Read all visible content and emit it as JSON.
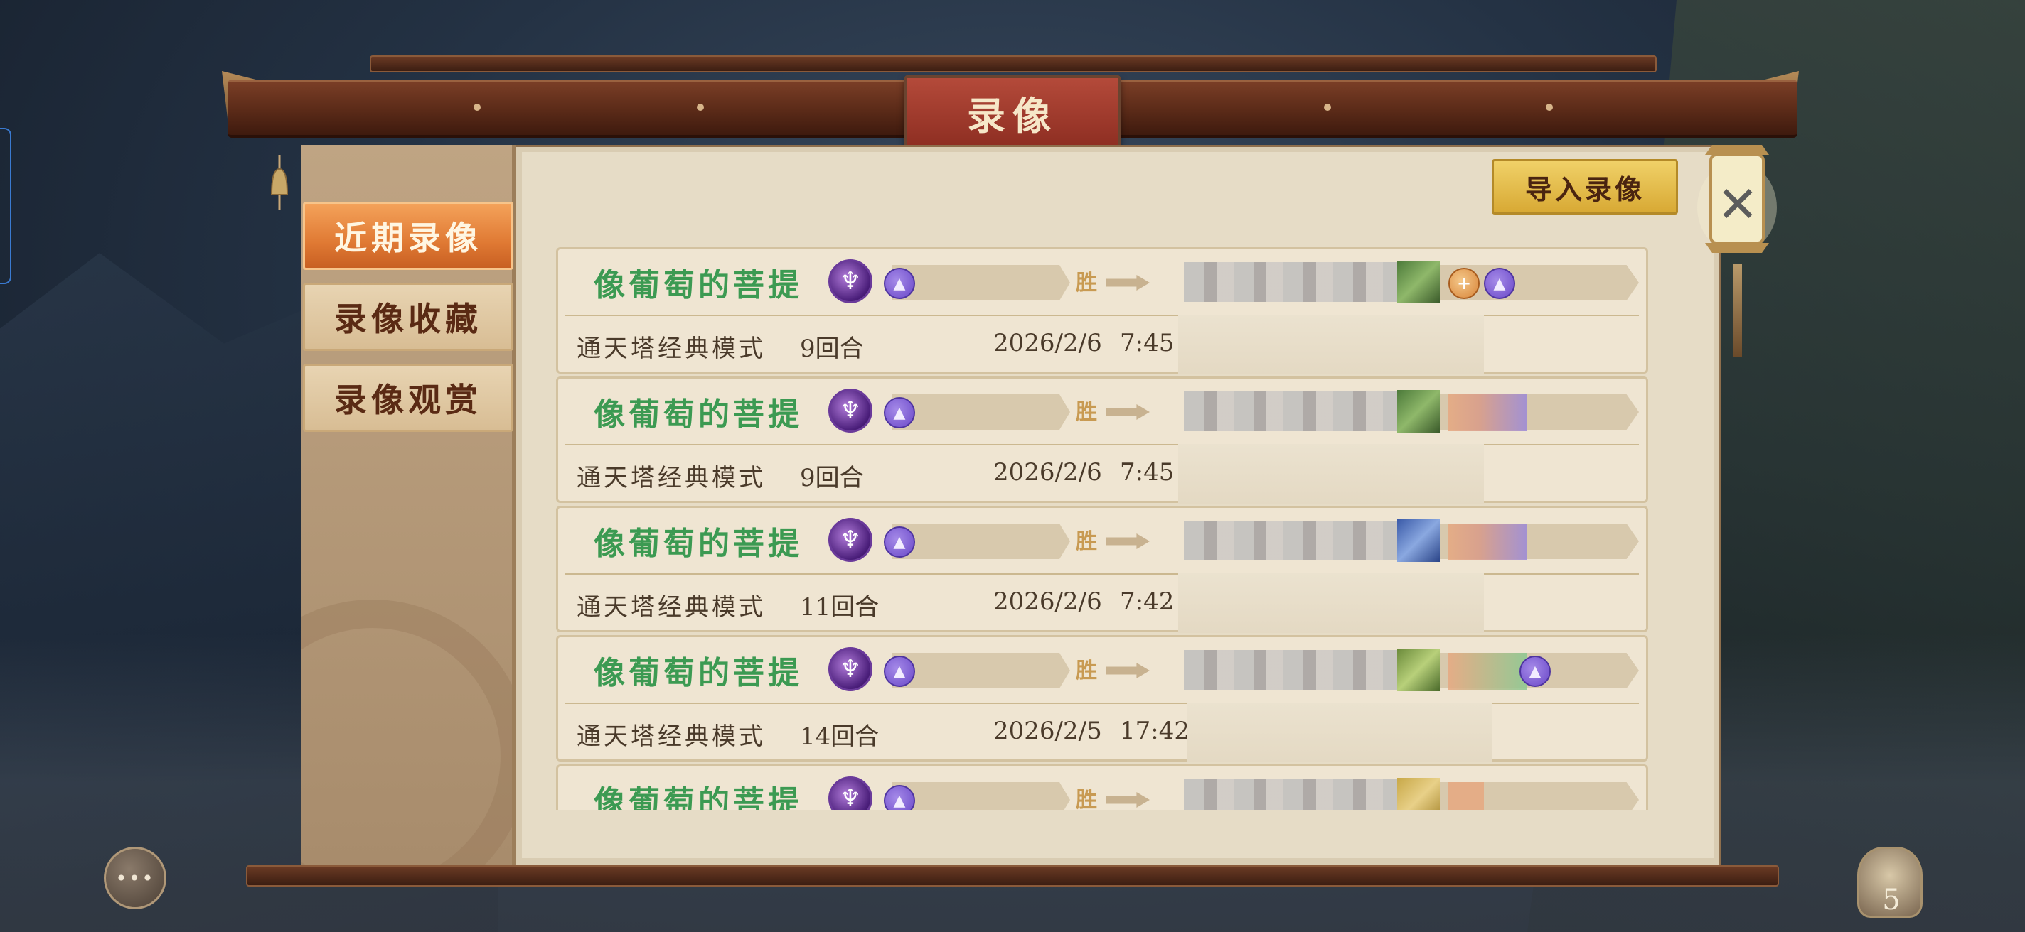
{
  "window": {
    "title": "录像"
  },
  "toolbar": {
    "import_label": "导入录像",
    "close_icon": "✕"
  },
  "sidebar": {
    "items": [
      {
        "label": "近期录像",
        "active": true
      },
      {
        "label": "录像收藏",
        "active": false
      },
      {
        "label": "录像观赏",
        "active": false
      }
    ]
  },
  "colors": {
    "accent_orange": "#e07a34",
    "name_green": "#3c9a52",
    "title_red": "#8e2e22",
    "import_gold": "#d8a934"
  },
  "icons": {
    "player_main": "hero-icon",
    "player_sub": "skill-icon",
    "result_arrow": "arrow-right-icon",
    "chat": "chat-icon",
    "bag": "bag-icon"
  },
  "records": [
    {
      "player": "像葡萄的菩提",
      "result": "胜",
      "mode": "通天塔经典模式",
      "rounds": "9回合",
      "date": "2026/2/6",
      "time": "7:45"
    },
    {
      "player": "像葡萄的菩提",
      "result": "胜",
      "mode": "通天塔经典模式",
      "rounds": "9回合",
      "date": "2026/2/6",
      "time": "7:45"
    },
    {
      "player": "像葡萄的菩提",
      "result": "胜",
      "mode": "通天塔经典模式",
      "rounds": "11回合",
      "date": "2026/2/6",
      "time": "7:42"
    },
    {
      "player": "像葡萄的菩提",
      "result": "胜",
      "mode": "通天塔经典模式",
      "rounds": "14回合",
      "date": "2026/2/5",
      "time": "17:42"
    },
    {
      "player": "像葡萄的菩提",
      "result": "胜",
      "mode": "",
      "rounds": "",
      "date": "",
      "time": ""
    }
  ],
  "bottom": {
    "chat_glyph": "•••",
    "bag_count": "5"
  }
}
